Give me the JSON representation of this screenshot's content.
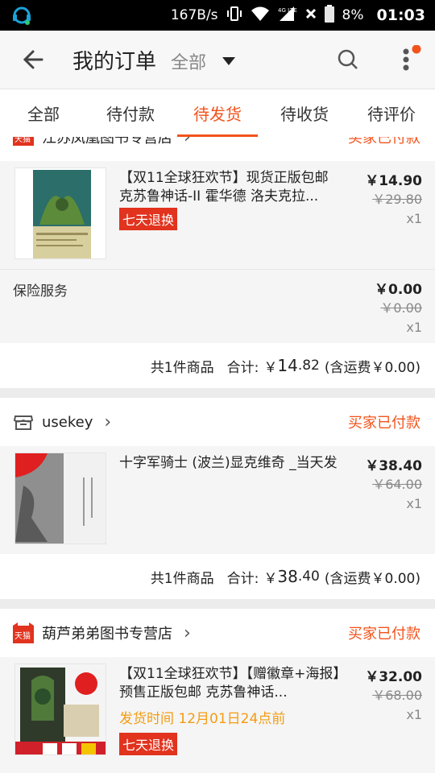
{
  "statusbar": {
    "speed": "167B/s",
    "battery": "8%",
    "time": "01:03",
    "network": "4G LTE"
  },
  "header": {
    "title": "我的订单",
    "filter": "全部"
  },
  "tabs": [
    {
      "label": "全部"
    },
    {
      "label": "待付款"
    },
    {
      "label": "待发货"
    },
    {
      "label": "待收货"
    },
    {
      "label": "待评价"
    }
  ],
  "colors": {
    "accent": "#f2531b",
    "tmall_red": "#e1331e",
    "ship_orange": "#f39c12"
  },
  "orders": [
    {
      "store_name": "江苏凤凰图书专营店",
      "store_badge": "天猫",
      "status": "买家已付款",
      "item": {
        "title": "【双11全球狂欢节】现货正版包邮 克苏鲁神话-II 霍华德 洛夫克拉...",
        "tag": "七天退换",
        "price": "￥14.90",
        "old_price": "￥29.80",
        "qty": "x1"
      },
      "insurance": {
        "label": "保险服务",
        "price": "￥0.00",
        "old_price": "￥0.00",
        "qty": "x1"
      },
      "total": {
        "count_label": "共1件商品",
        "sum_label": "合计:",
        "currency": "￥",
        "sum_int": "14",
        "sum_dec": ".82",
        "shipping": "(含运费￥0.00)"
      }
    },
    {
      "store_name": "usekey",
      "status": "买家已付款",
      "item": {
        "title": "十字军骑士 (波兰)显克维奇 _当天发",
        "price": "￥38.40",
        "old_price": "￥64.00",
        "qty": "x1"
      },
      "total": {
        "count_label": "共1件商品",
        "sum_label": "合计:",
        "currency": "￥",
        "sum_int": "38",
        "sum_dec": ".40",
        "shipping": "(含运费￥0.00)"
      }
    },
    {
      "store_name": "葫芦弟弟图书专营店",
      "store_badge": "天猫",
      "status": "买家已付款",
      "item": {
        "title": "【双11全球狂欢节】【赠徽章+海报】预售正版包邮 克苏鲁神话...",
        "ship_time": "发货时间 12月01日24点前",
        "tag": "七天退换",
        "price": "￥32.00",
        "old_price": "￥68.00",
        "qty": "x1"
      }
    }
  ]
}
